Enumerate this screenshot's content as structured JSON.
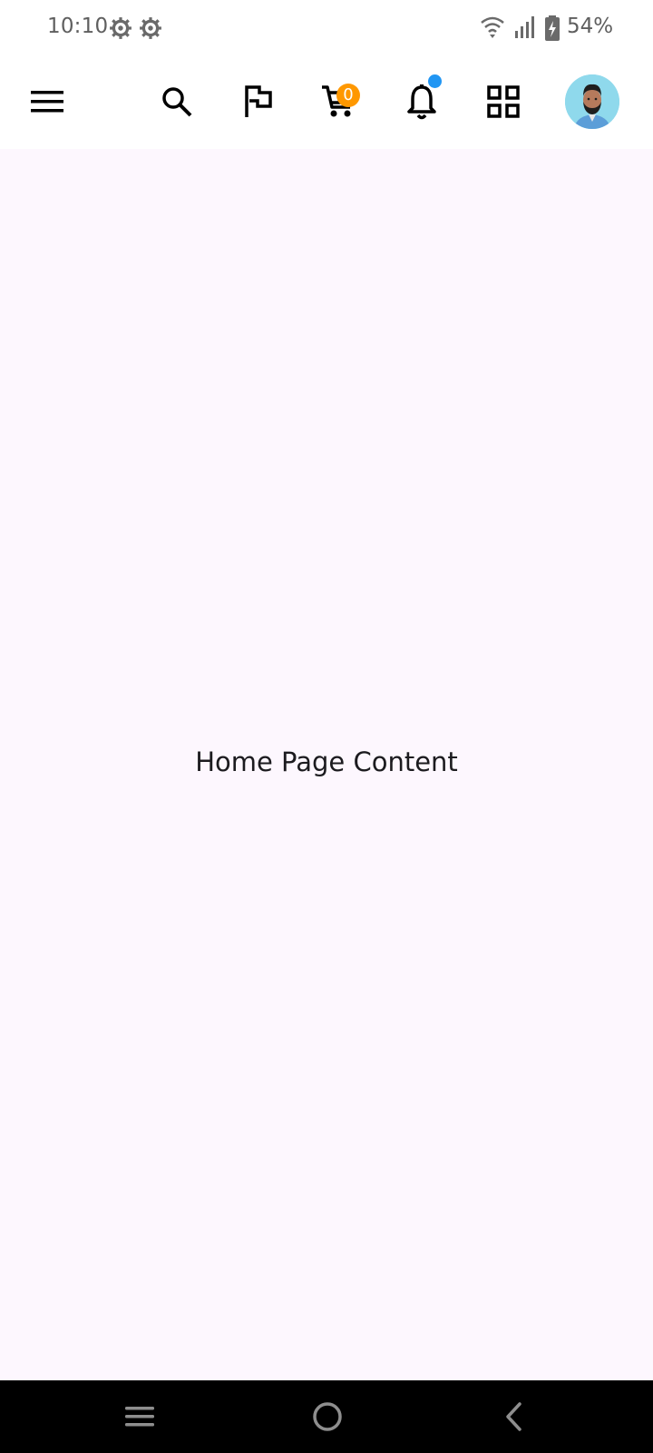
{
  "status_bar": {
    "time": "10:10",
    "battery": "54%",
    "icons": [
      "settings-gear-icon",
      "settings-gear-icon",
      "wifi-icon",
      "cell-signal-icon",
      "battery-charging-icon"
    ]
  },
  "app_bar": {
    "icons": [
      "menu-icon",
      "search-icon",
      "flag-icon",
      "cart-icon",
      "bell-icon",
      "grid-icon"
    ],
    "cart_badge": "0",
    "colors": {
      "cart_badge": "#FF9800",
      "notification_dot": "#2196F3",
      "avatar_bg": "#8FD9EC"
    }
  },
  "main": {
    "content_text": "Home Page Content"
  },
  "nav_bar": {
    "icons": [
      "recents-icon",
      "home-icon",
      "back-icon"
    ]
  }
}
